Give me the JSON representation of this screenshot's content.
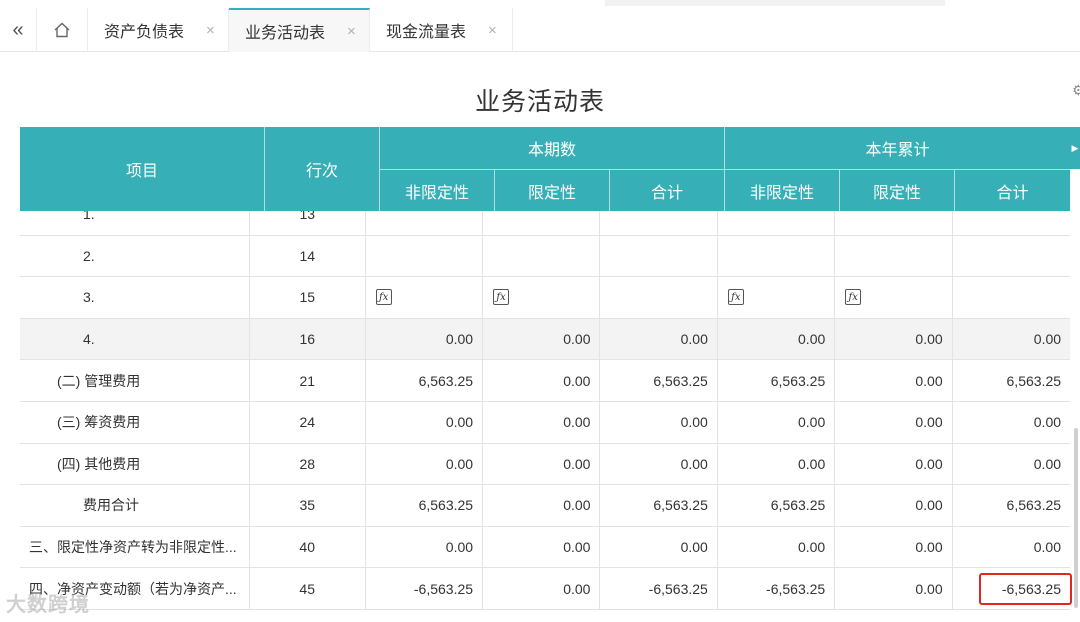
{
  "tabs": {
    "collapse_icon": "«",
    "home_icon": "home-icon",
    "items": [
      {
        "label": "资产负债表",
        "close": "×"
      },
      {
        "label": "业务活动表",
        "close": "×"
      },
      {
        "label": "现金流量表",
        "close": "×"
      }
    ]
  },
  "title": "业务活动表",
  "header": {
    "item": "项目",
    "line": "行次",
    "current_group": "本期数",
    "ytd_group": "本年累计",
    "cols": [
      "非限定性",
      "限定性",
      "合计",
      "非限定性",
      "限定性",
      "合计"
    ]
  },
  "rows": [
    {
      "item": "1.",
      "line": "13",
      "vals": [
        "",
        "",
        "",
        "",
        "",
        ""
      ]
    },
    {
      "item": "2.",
      "line": "14",
      "vals": [
        "",
        "",
        "",
        "",
        "",
        ""
      ]
    },
    {
      "item": "3.",
      "line": "15",
      "vals": [
        "ƒx",
        "ƒx",
        "",
        "ƒx",
        "ƒx",
        ""
      ]
    },
    {
      "item": "4.",
      "line": "16",
      "vals": [
        "0.00",
        "0.00",
        "0.00",
        "0.00",
        "0.00",
        "0.00"
      ]
    },
    {
      "item": "(二) 管理费用",
      "line": "21",
      "vals": [
        "6,563.25",
        "0.00",
        "6,563.25",
        "6,563.25",
        "0.00",
        "6,563.25"
      ]
    },
    {
      "item": "(三) 筹资费用",
      "line": "24",
      "vals": [
        "0.00",
        "0.00",
        "0.00",
        "0.00",
        "0.00",
        "0.00"
      ]
    },
    {
      "item": "(四) 其他费用",
      "line": "28",
      "vals": [
        "0.00",
        "0.00",
        "0.00",
        "0.00",
        "0.00",
        "0.00"
      ]
    },
    {
      "item": "费用合计",
      "line": "35",
      "vals": [
        "6,563.25",
        "0.00",
        "6,563.25",
        "6,563.25",
        "0.00",
        "6,563.25"
      ]
    },
    {
      "item": "三、限定性净资产转为非限定性...",
      "line": "40",
      "vals": [
        "0.00",
        "0.00",
        "0.00",
        "0.00",
        "0.00",
        "0.00"
      ]
    },
    {
      "item": "四、净资产变动额（若为净资产...",
      "line": "45",
      "vals": [
        "-6,563.25",
        "0.00",
        "-6,563.25",
        "-6,563.25",
        "0.00",
        "-6,563.25"
      ]
    }
  ],
  "watermark": "大数跨境",
  "colors": {
    "header_bg": "#36b0b6",
    "highlight": "#e8241f"
  }
}
